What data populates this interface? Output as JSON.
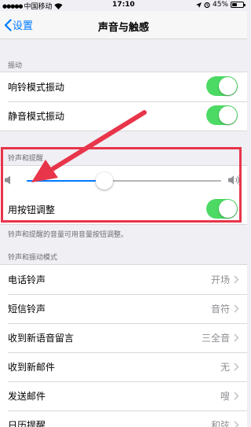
{
  "status_bar": {
    "carrier": "中国移动",
    "time": "17:10",
    "battery": "45%",
    "battery_level": 0.45
  },
  "nav": {
    "back_label": "设置",
    "title": "声音与触感"
  },
  "vibration": {
    "header": "振动",
    "rows": [
      {
        "label": "响铃模式振动",
        "on": true
      },
      {
        "label": "静音模式振动",
        "on": true
      }
    ]
  },
  "ringer": {
    "header": "铃声和提醒",
    "volume_level": 0.4,
    "adjust_label": "用按钮调整",
    "adjust_on": true,
    "footer": "铃声和提醒的音量可用音量按钮调整。"
  },
  "patterns": {
    "header": "铃声和振动模式",
    "rows": [
      {
        "label": "电话铃声",
        "value": "开场"
      },
      {
        "label": "短信铃声",
        "value": "音符"
      },
      {
        "label": "收到新语音留言",
        "value": "三全音"
      },
      {
        "label": "收到新邮件",
        "value": "无"
      },
      {
        "label": "发送邮件",
        "value": "嗖"
      },
      {
        "label": "日历提醒",
        "value": "和弦"
      }
    ]
  },
  "colors": {
    "accent": "#007aff",
    "toggle_on": "#4cd964",
    "annotation": "#e8354a"
  }
}
